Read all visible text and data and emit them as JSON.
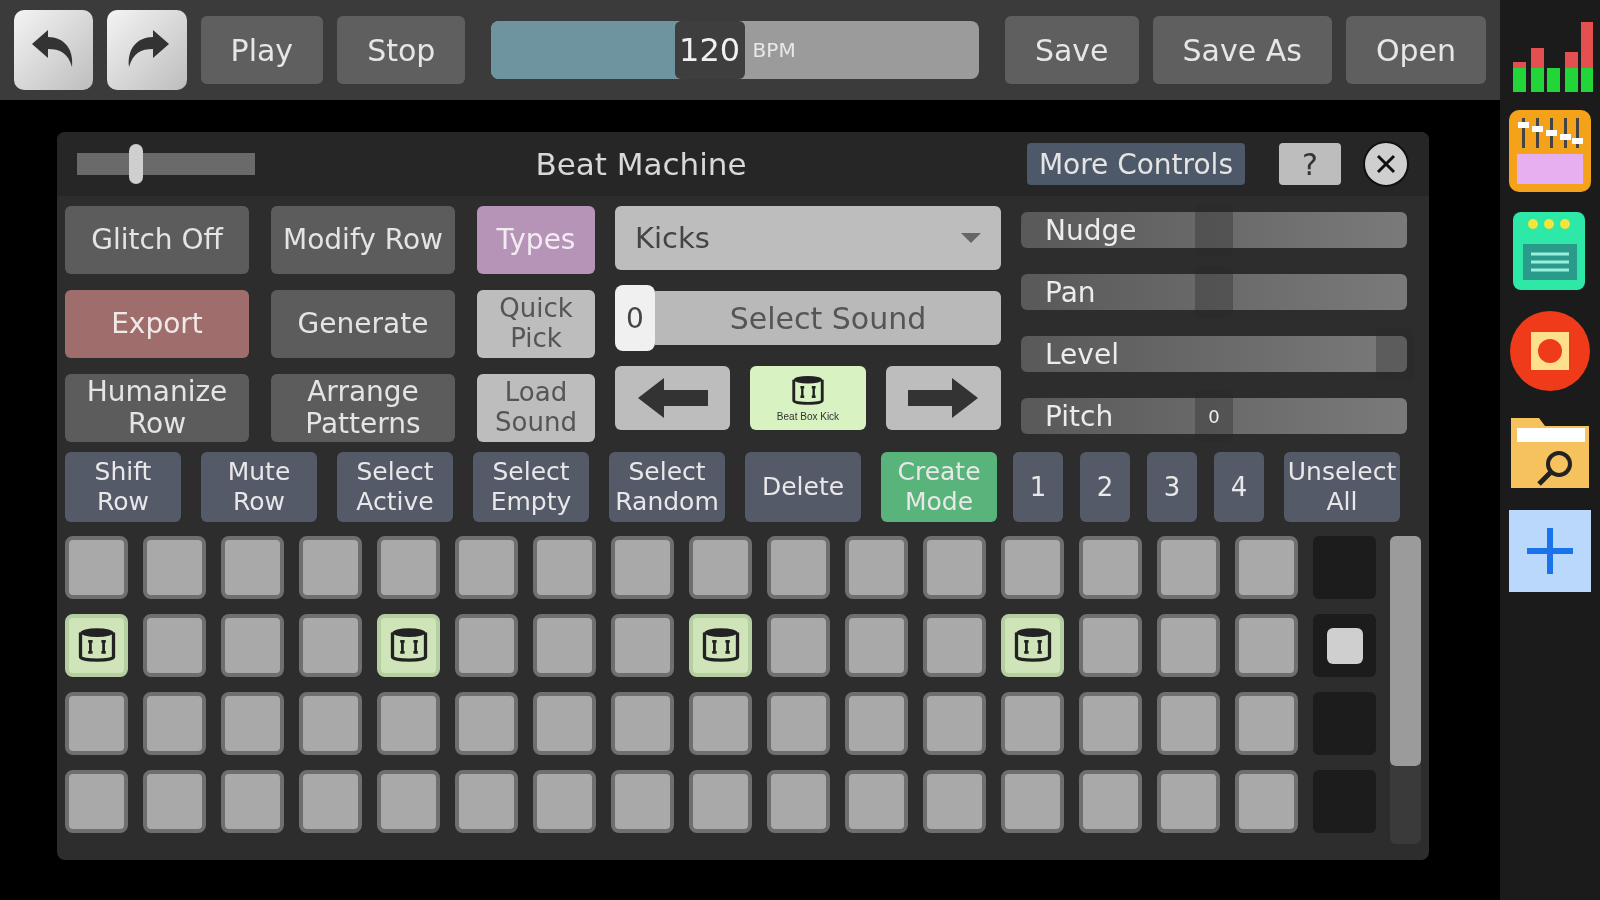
{
  "toolbar": {
    "play": "Play",
    "stop": "Stop",
    "tempo": {
      "value": "120",
      "unit": "BPM",
      "level": 0.38
    },
    "file_buttons": [
      "Save",
      "Save As",
      "Open"
    ]
  },
  "panel": {
    "title": "Beat Machine",
    "zoom": {
      "level": 0.33
    },
    "more_controls": "More Controls",
    "help": "?",
    "left_buttons": [
      {
        "label": "Glitch Off",
        "kind": "normal"
      },
      {
        "label": "Modify Row",
        "kind": "normal"
      },
      {
        "label": "Types",
        "kind": "category"
      },
      {
        "label": "Export",
        "kind": "danger"
      },
      {
        "label": "Generate",
        "kind": "normal"
      },
      {
        "label": "Quick Pick",
        "kind": "light"
      },
      {
        "label": "Humanize Row",
        "kind": "normal"
      },
      {
        "label": "Arrange Patterns",
        "kind": "normal"
      },
      {
        "label": "Load Sound",
        "kind": "light"
      }
    ],
    "type_select": {
      "value": "Kicks"
    },
    "sound": {
      "index": "0",
      "label": "Select Sound",
      "preview": "Beat Box Kick"
    },
    "sliders": [
      {
        "label": "Nudge",
        "level": 0.5
      },
      {
        "label": "Pan",
        "level": 0.5
      },
      {
        "label": "Level",
        "level": 0.97
      },
      {
        "label": "Pitch",
        "level": 0.5,
        "reading": "0"
      }
    ],
    "row_buttons": [
      {
        "label": "Shift Row",
        "kind": "normal"
      },
      {
        "label": "Mute Row",
        "kind": "normal"
      },
      {
        "label": "Select Active",
        "kind": "normal"
      },
      {
        "label": "Select Empty",
        "kind": "normal"
      },
      {
        "label": "Select Random",
        "kind": "normal"
      },
      {
        "label": "Delete",
        "kind": "normal"
      },
      {
        "label": "Create Mode",
        "kind": "active"
      }
    ],
    "patterns": [
      {
        "label": "1",
        "selected": false
      },
      {
        "label": "2",
        "selected": false
      },
      {
        "label": "3",
        "selected": false
      },
      {
        "label": "4",
        "selected": false
      }
    ],
    "unselect_all": "Unselect All",
    "grid": [
      {
        "marker": false,
        "cells": [
          false,
          false,
          false,
          false,
          false,
          false,
          false,
          false,
          false,
          false,
          false,
          false,
          false,
          false,
          false,
          false
        ]
      },
      {
        "marker": true,
        "cells": [
          true,
          false,
          false,
          false,
          true,
          false,
          false,
          false,
          true,
          false,
          false,
          false,
          true,
          false,
          false,
          false
        ]
      },
      {
        "marker": false,
        "cells": [
          false,
          false,
          false,
          false,
          false,
          false,
          false,
          false,
          false,
          false,
          false,
          false,
          false,
          false,
          false,
          false
        ]
      },
      {
        "marker": false,
        "cells": [
          false,
          false,
          false,
          false,
          false,
          false,
          false,
          false,
          false,
          false,
          false,
          false,
          false,
          false,
          false,
          false
        ]
      }
    ]
  }
}
